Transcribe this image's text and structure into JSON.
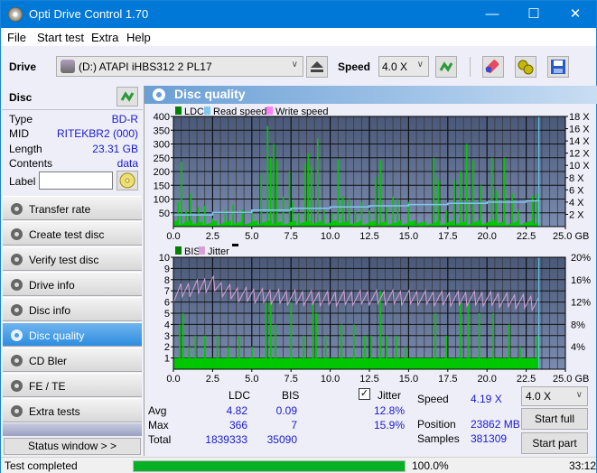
{
  "window": {
    "title": "Opti Drive Control 1.70",
    "minimize": "—",
    "maximize": "☐",
    "close": "✕"
  },
  "menu": [
    "File",
    "Start test",
    "Extra",
    "Help"
  ],
  "toolbar": {
    "drive_label": "Drive",
    "drive_value": "(D:)  ATAPI iHBS312   2 PL17",
    "speed_label": "Speed",
    "speed_value": "4.0 X"
  },
  "disc": {
    "header": "Disc",
    "rows": [
      {
        "key": "Type",
        "value": "BD-R"
      },
      {
        "key": "MID",
        "value": "RITEKBR2 (000)"
      },
      {
        "key": "Length",
        "value": "23.31 GB"
      },
      {
        "key": "Contents",
        "value": "data"
      }
    ],
    "label_key": "Label",
    "label_value": ""
  },
  "nav": [
    {
      "label": "Transfer rate",
      "active": false
    },
    {
      "label": "Create test disc",
      "active": false
    },
    {
      "label": "Verify test disc",
      "active": false
    },
    {
      "label": "Drive info",
      "active": false
    },
    {
      "label": "Disc info",
      "active": false
    },
    {
      "label": "Disc quality",
      "active": true
    },
    {
      "label": "CD Bler",
      "active": false
    },
    {
      "label": "FE / TE",
      "active": false
    },
    {
      "label": "Extra tests",
      "active": false
    }
  ],
  "status_window_label": "Status window > >",
  "panel_title": "Disc quality",
  "colors": {
    "ldc": "#00c800",
    "read": "#7ec8f0",
    "write": "#ff80ff",
    "jitter": "#d8a0d8",
    "plot_bg_top": "#4a5878",
    "plot_bg_bottom": "#7a8cb0",
    "accent": "#0078d7"
  },
  "chart_data": [
    {
      "type": "bar",
      "title": "LDC / Read speed",
      "legend": [
        "LDC",
        "Read speed",
        "Write speed"
      ],
      "legend_position": "top-left",
      "xlabel": "GB",
      "xlim": [
        0,
        25
      ],
      "x_ticks": [
        "0.0",
        "2.5",
        "5.0",
        "7.5",
        "10.0",
        "12.5",
        "15.0",
        "17.5",
        "20.0",
        "22.5",
        "25.0 GB"
      ],
      "ylim": [
        0,
        400
      ],
      "y_ticks": [
        "50",
        "100",
        "150",
        "200",
        "250",
        "300",
        "350",
        "400"
      ],
      "y2lim": [
        0,
        18
      ],
      "y2_ticks": [
        "2 X",
        "4 X",
        "6 X",
        "8 X",
        "10 X",
        "12 X",
        "14 X",
        "16 X",
        "18 X"
      ],
      "grid": true,
      "data_end_gb": 23.31,
      "ldc_peaks": [
        {
          "x": 0.3,
          "y": 90
        },
        {
          "x": 0.5,
          "y": 235
        },
        {
          "x": 0.8,
          "y": 60
        },
        {
          "x": 1.1,
          "y": 120
        },
        {
          "x": 1.6,
          "y": 70
        },
        {
          "x": 2.0,
          "y": 75
        },
        {
          "x": 2.5,
          "y": 30
        },
        {
          "x": 3.3,
          "y": 60
        },
        {
          "x": 3.8,
          "y": 80
        },
        {
          "x": 4.4,
          "y": 60
        },
        {
          "x": 5.0,
          "y": 50
        },
        {
          "x": 5.6,
          "y": 190
        },
        {
          "x": 6.0,
          "y": 365
        },
        {
          "x": 6.2,
          "y": 250
        },
        {
          "x": 6.4,
          "y": 300
        },
        {
          "x": 6.6,
          "y": 240
        },
        {
          "x": 7.0,
          "y": 110
        },
        {
          "x": 7.4,
          "y": 200
        },
        {
          "x": 7.6,
          "y": 90
        },
        {
          "x": 8.0,
          "y": 50
        },
        {
          "x": 8.4,
          "y": 230
        },
        {
          "x": 8.6,
          "y": 265
        },
        {
          "x": 8.8,
          "y": 220
        },
        {
          "x": 9.2,
          "y": 320
        },
        {
          "x": 9.6,
          "y": 60
        },
        {
          "x": 10.1,
          "y": 50
        },
        {
          "x": 10.5,
          "y": 245
        },
        {
          "x": 10.8,
          "y": 110
        },
        {
          "x": 11.2,
          "y": 100
        },
        {
          "x": 11.6,
          "y": 60
        },
        {
          "x": 12.0,
          "y": 90
        },
        {
          "x": 12.5,
          "y": 60
        },
        {
          "x": 12.9,
          "y": 180
        },
        {
          "x": 13.2,
          "y": 240
        },
        {
          "x": 13.6,
          "y": 70
        },
        {
          "x": 14.0,
          "y": 110
        },
        {
          "x": 14.3,
          "y": 100
        },
        {
          "x": 15.0,
          "y": 90
        },
        {
          "x": 16.6,
          "y": 250
        },
        {
          "x": 16.9,
          "y": 170
        },
        {
          "x": 17.4,
          "y": 60
        },
        {
          "x": 17.9,
          "y": 170
        },
        {
          "x": 18.3,
          "y": 200
        },
        {
          "x": 18.7,
          "y": 300
        },
        {
          "x": 19.1,
          "y": 240
        },
        {
          "x": 19.6,
          "y": 150
        },
        {
          "x": 20.3,
          "y": 250
        },
        {
          "x": 20.6,
          "y": 130
        },
        {
          "x": 21.1,
          "y": 250
        },
        {
          "x": 21.6,
          "y": 120
        },
        {
          "x": 22.0,
          "y": 60
        },
        {
          "x": 22.9,
          "y": 110
        },
        {
          "x": 23.2,
          "y": 120
        }
      ],
      "read_speed": [
        {
          "x": 0.0,
          "y": 1.9
        },
        {
          "x": 2.5,
          "y": 2.3
        },
        {
          "x": 5.0,
          "y": 2.7
        },
        {
          "x": 7.5,
          "y": 3.0
        },
        {
          "x": 10.0,
          "y": 3.2
        },
        {
          "x": 12.5,
          "y": 3.4
        },
        {
          "x": 15.0,
          "y": 3.6
        },
        {
          "x": 17.5,
          "y": 3.8
        },
        {
          "x": 20.0,
          "y": 4.0
        },
        {
          "x": 22.5,
          "y": 4.2
        },
        {
          "x": 23.31,
          "y": 4.4
        }
      ]
    },
    {
      "type": "bar",
      "title": "BIS / Jitter",
      "legend": [
        "BIS",
        "Jitter"
      ],
      "legend_position": "top-left",
      "xlabel": "GB",
      "xlim": [
        0,
        25
      ],
      "x_ticks": [
        "0.0",
        "2.5",
        "5.0",
        "7.5",
        "10.0",
        "12.5",
        "15.0",
        "17.5",
        "20.0",
        "22.5",
        "25.0 GB"
      ],
      "ylim": [
        0,
        10
      ],
      "y_ticks": [
        "1",
        "2",
        "3",
        "4",
        "5",
        "6",
        "7",
        "8",
        "9",
        "10"
      ],
      "y2lim": [
        0,
        20
      ],
      "y2_ticks": [
        "4%",
        "8%",
        "12%",
        "16%",
        "20%"
      ],
      "grid": true,
      "data_end_gb": 23.31,
      "bis_peaks": [
        {
          "x": 0.4,
          "y": 4
        },
        {
          "x": 0.6,
          "y": 5
        },
        {
          "x": 1.0,
          "y": 2
        },
        {
          "x": 1.4,
          "y": 3
        },
        {
          "x": 2.0,
          "y": 3
        },
        {
          "x": 2.8,
          "y": 3
        },
        {
          "x": 3.5,
          "y": 2
        },
        {
          "x": 4.2,
          "y": 3
        },
        {
          "x": 5.0,
          "y": 2
        },
        {
          "x": 5.9,
          "y": 6
        },
        {
          "x": 6.2,
          "y": 6
        },
        {
          "x": 6.5,
          "y": 4
        },
        {
          "x": 7.5,
          "y": 6
        },
        {
          "x": 8.3,
          "y": 3
        },
        {
          "x": 8.9,
          "y": 6
        },
        {
          "x": 9.1,
          "y": 5
        },
        {
          "x": 9.7,
          "y": 3
        },
        {
          "x": 10.7,
          "y": 4
        },
        {
          "x": 11.5,
          "y": 4
        },
        {
          "x": 12.2,
          "y": 3
        },
        {
          "x": 12.6,
          "y": 3
        },
        {
          "x": 13.2,
          "y": 7
        },
        {
          "x": 13.6,
          "y": 3
        },
        {
          "x": 14.2,
          "y": 3
        },
        {
          "x": 14.8,
          "y": 2
        },
        {
          "x": 16.7,
          "y": 5
        },
        {
          "x": 17.4,
          "y": 3
        },
        {
          "x": 18.3,
          "y": 6
        },
        {
          "x": 18.8,
          "y": 6
        },
        {
          "x": 19.5,
          "y": 5
        },
        {
          "x": 20.4,
          "y": 5
        },
        {
          "x": 21.4,
          "y": 4
        },
        {
          "x": 22.1,
          "y": 2
        },
        {
          "x": 23.2,
          "y": 3
        }
      ],
      "jitter_pct": [
        {
          "x": 0.0,
          "y": 13.2
        },
        {
          "x": 0.5,
          "y": 14.0
        },
        {
          "x": 1.0,
          "y": 14.2
        },
        {
          "x": 1.5,
          "y": 14.6
        },
        {
          "x": 2.0,
          "y": 15.0
        },
        {
          "x": 2.5,
          "y": 15.4
        },
        {
          "x": 3.0,
          "y": 14.4
        },
        {
          "x": 4.0,
          "y": 13.4
        },
        {
          "x": 5.0,
          "y": 13.2
        },
        {
          "x": 6.0,
          "y": 13.0
        },
        {
          "x": 7.5,
          "y": 12.8
        },
        {
          "x": 10.0,
          "y": 12.6
        },
        {
          "x": 12.5,
          "y": 12.8
        },
        {
          "x": 15.0,
          "y": 12.8
        },
        {
          "x": 17.5,
          "y": 12.6
        },
        {
          "x": 20.0,
          "y": 12.6
        },
        {
          "x": 22.5,
          "y": 12.0
        },
        {
          "x": 23.31,
          "y": 11.8
        }
      ]
    }
  ],
  "stats": {
    "col_ldc": "LDC",
    "col_bis": "BIS",
    "jitter_label": "Jitter",
    "jitter_checked": true,
    "rows": [
      {
        "label": "Avg",
        "ldc": "4.82",
        "bis": "0.09",
        "jitter": "12.8%"
      },
      {
        "label": "Max",
        "ldc": "366",
        "bis": "7",
        "jitter": "15.9%"
      },
      {
        "label": "Total",
        "ldc": "1839333",
        "bis": "35090",
        "jitter": ""
      }
    ],
    "speed_label": "Speed",
    "speed_value": "4.19 X",
    "position_label": "Position",
    "position_value": "23862 MB",
    "samples_label": "Samples",
    "samples_value": "381309",
    "speed_select": "4.0 X",
    "start_full": "Start full",
    "start_part": "Start part"
  },
  "statusbar": {
    "text": "Test completed",
    "progress_pct": 100.0,
    "progress_label": "100.0%",
    "elapsed": "33:12"
  }
}
